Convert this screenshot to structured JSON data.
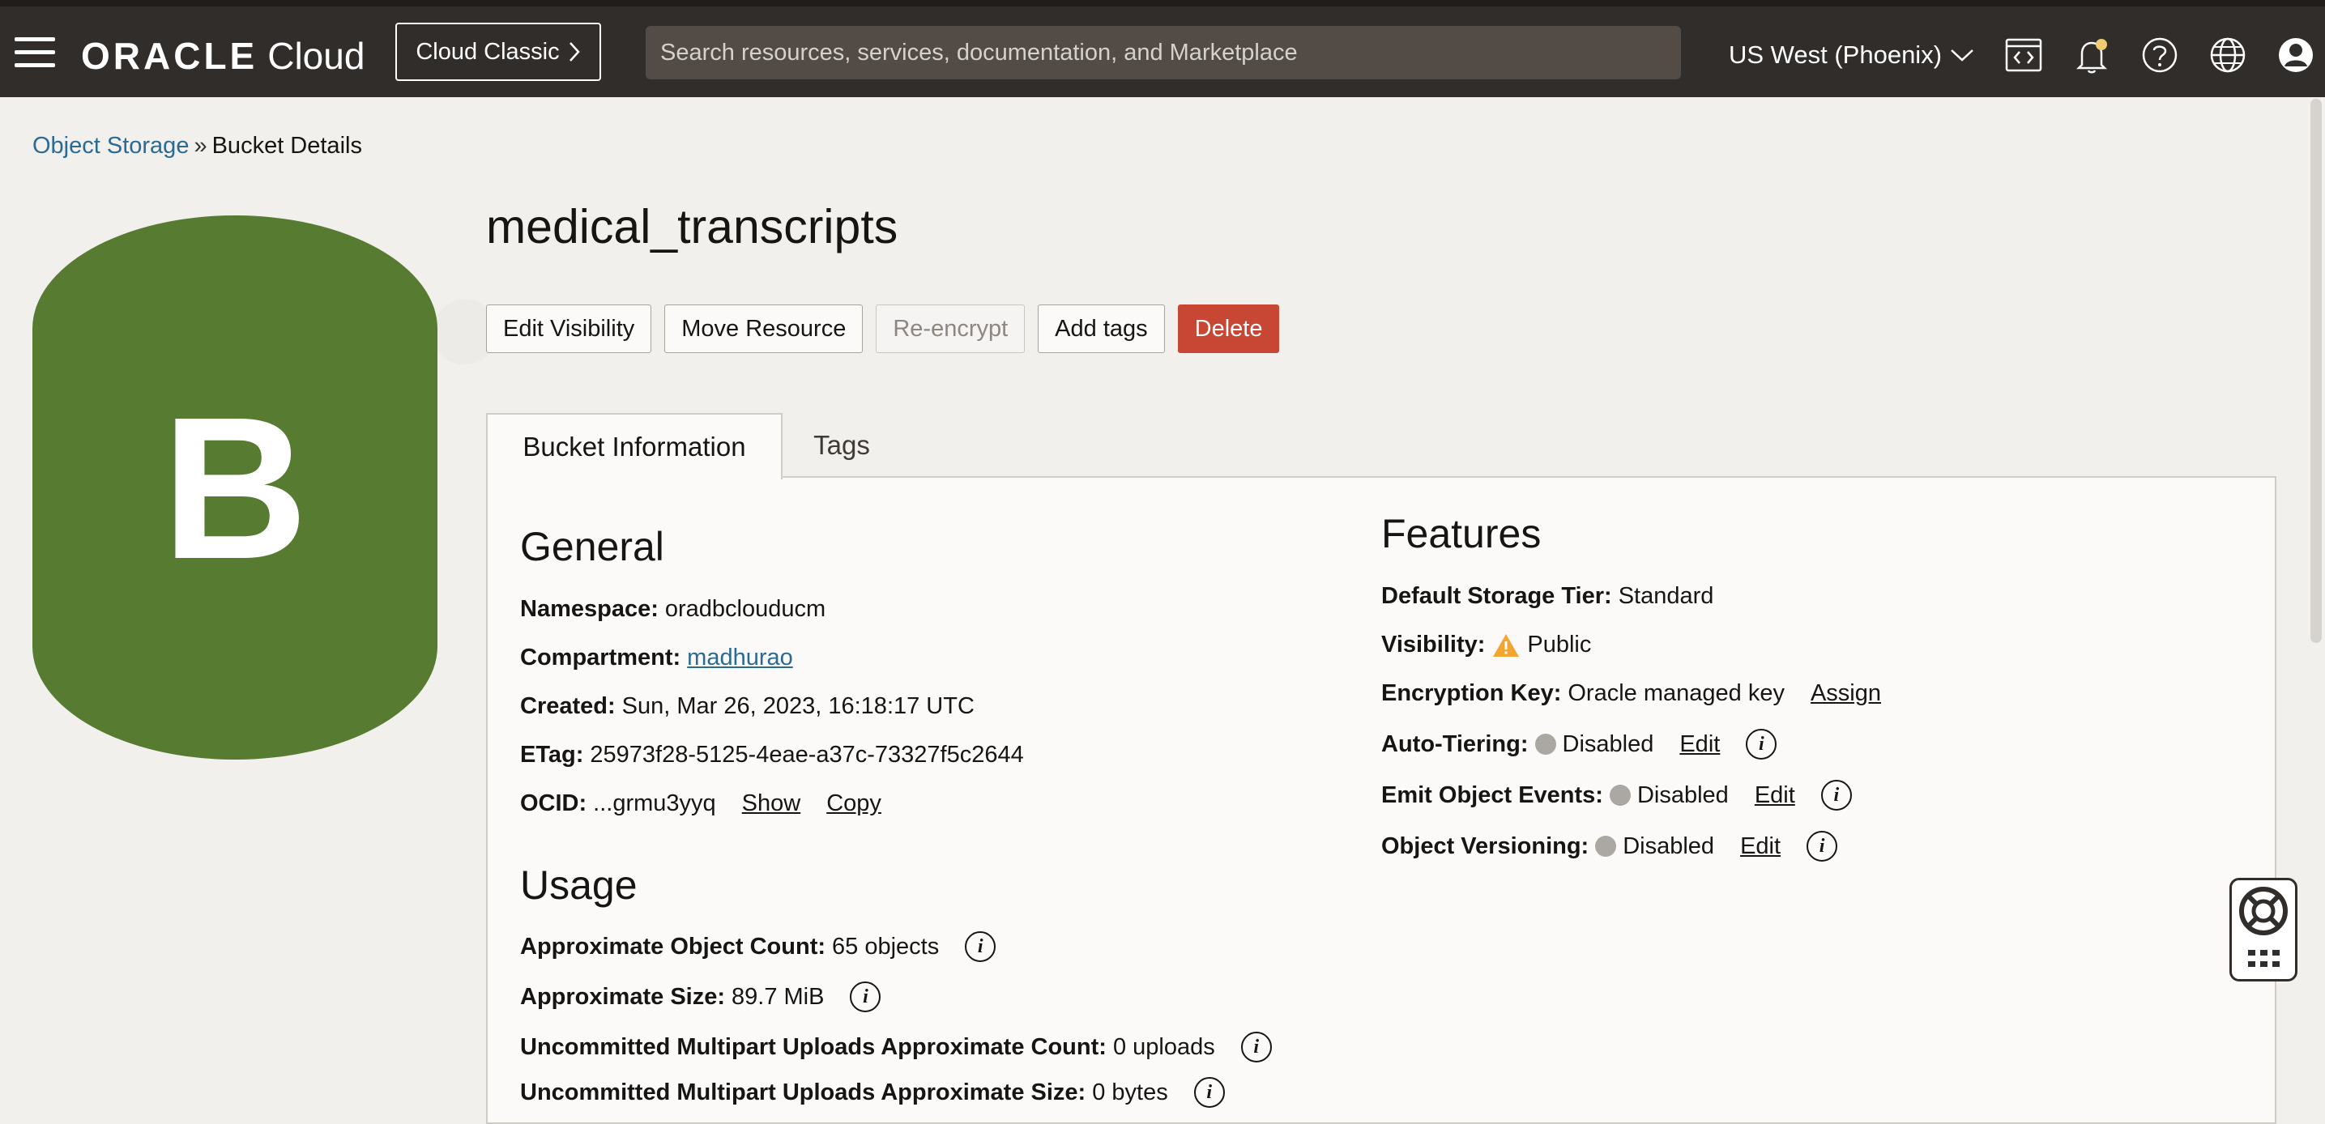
{
  "header": {
    "logo_brand": "ORACLE",
    "logo_product": "Cloud",
    "classic_label": "Cloud Classic",
    "search_placeholder": "Search resources, services, documentation, and Marketplace",
    "region": "US West (Phoenix)"
  },
  "breadcrumb": {
    "parent": "Object Storage",
    "separator": "»",
    "current": "Bucket Details"
  },
  "bucket": {
    "logo_letter": "B",
    "name": "medical_transcripts",
    "logo_color": "#567b31"
  },
  "actions": {
    "edit_visibility": "Edit Visibility",
    "move_resource": "Move Resource",
    "reencrypt": "Re-encrypt",
    "add_tags": "Add tags",
    "delete": "Delete"
  },
  "tabs": {
    "bucket_information": "Bucket Information",
    "tags": "Tags"
  },
  "general": {
    "title": "General",
    "namespace_label": "Namespace:",
    "namespace": "oradbclouducm",
    "compartment_label": "Compartment:",
    "compartment": "madhurao",
    "created_label": "Created:",
    "created": "Sun, Mar 26, 2023, 16:18:17 UTC",
    "etag_label": "ETag:",
    "etag": "25973f28-5125-4eae-a37c-73327f5c2644",
    "ocid_label": "OCID:",
    "ocid": "...grmu3yyq",
    "show": "Show",
    "copy": "Copy"
  },
  "usage": {
    "title": "Usage",
    "object_count_label": "Approximate Object Count:",
    "object_count": "65 objects",
    "size_label": "Approximate Size:",
    "size": "89.7 MiB",
    "multipart_count_label": "Uncommitted Multipart Uploads Approximate Count:",
    "multipart_count": "0 uploads",
    "multipart_size_label": "Uncommitted Multipart Uploads Approximate Size:",
    "multipart_size": "0 bytes"
  },
  "features": {
    "title": "Features",
    "storage_tier_label": "Default Storage Tier:",
    "storage_tier": "Standard",
    "visibility_label": "Visibility:",
    "visibility": "Public",
    "encryption_label": "Encryption Key:",
    "encryption": "Oracle managed key",
    "assign": "Assign",
    "auto_tiering_label": "Auto-Tiering:",
    "auto_tiering": "Disabled",
    "emit_events_label": "Emit Object Events:",
    "emit_events": "Disabled",
    "versioning_label": "Object Versioning:",
    "versioning": "Disabled",
    "edit": "Edit",
    "info_glyph": "i"
  }
}
